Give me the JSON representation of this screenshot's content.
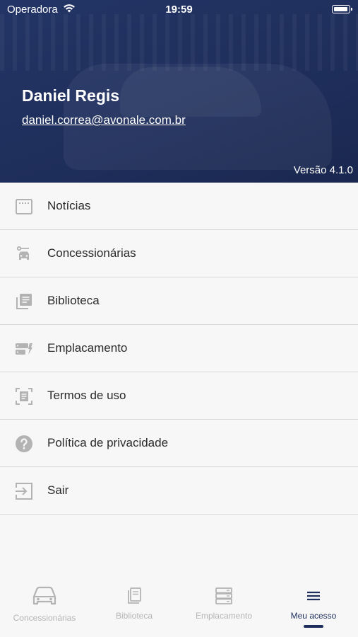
{
  "status_bar": {
    "carrier": "Operadora",
    "time": "19:59"
  },
  "header": {
    "user_name": "Daniel Regis",
    "user_email": "daniel.correa@avonale.com.br",
    "version": "Versão 4.1.0"
  },
  "menu": {
    "items": [
      {
        "label": "Notícias",
        "icon": "news-icon"
      },
      {
        "label": "Concessionárias",
        "icon": "dealership-icon"
      },
      {
        "label": "Biblioteca",
        "icon": "library-icon"
      },
      {
        "label": "Emplacamento",
        "icon": "license-plate-icon"
      },
      {
        "label": "Termos de uso",
        "icon": "terms-icon"
      },
      {
        "label": "Política de privacidade",
        "icon": "help-circle-icon"
      },
      {
        "label": "Sair",
        "icon": "logout-icon"
      }
    ]
  },
  "tabbar": {
    "tabs": [
      {
        "label": "Concessionárias",
        "icon": "car-icon",
        "active": false
      },
      {
        "label": "Biblioteca",
        "icon": "book-icon",
        "active": false
      },
      {
        "label": "Emplacamento",
        "icon": "server-icon",
        "active": false
      },
      {
        "label": "Meu acesso",
        "icon": "menu-icon",
        "active": true
      }
    ]
  },
  "colors": {
    "header_bg": "#1f2f5c",
    "accent": "#1f2f5c",
    "icon_gray": "#b3b3b3",
    "background": "#f7f7f7"
  }
}
